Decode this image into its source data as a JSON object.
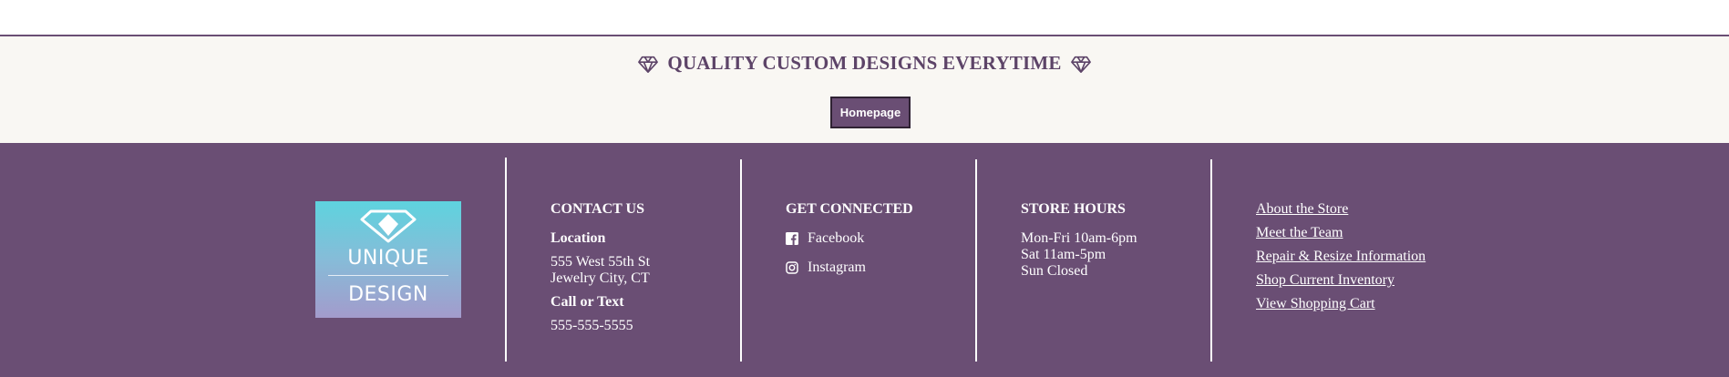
{
  "banner": {
    "tagline": "QUALITY CUSTOM DESIGNS EVERYTIME",
    "homepage_button": "Homepage",
    "icons": [
      "diamond-icon",
      "diamond-icon"
    ]
  },
  "logo": {
    "line1": "UNIQUE",
    "line2": "DESIGN"
  },
  "contact": {
    "heading": "CONTACT US",
    "location_label": "Location",
    "address_line1": "555 West 55th St",
    "address_line2": "Jewelry City, CT",
    "phone_label": "Call or Text",
    "phone": "555-555-5555"
  },
  "connected": {
    "heading": "GET CONNECTED",
    "items": [
      {
        "label": "Facebook",
        "icon": "facebook-icon"
      },
      {
        "label": "Instagram",
        "icon": "instagram-icon"
      }
    ]
  },
  "hours": {
    "heading": "STORE HOURS",
    "lines": [
      "Mon-Fri 10am-6pm",
      "Sat 11am-5pm",
      "Sun Closed"
    ]
  },
  "links": [
    "About the Store",
    "Meet the Team",
    "Repair & Resize Information",
    "Shop Current Inventory",
    "View Shopping Cart"
  ],
  "colors": {
    "brand_purple": "#6a4e74",
    "banner_bg": "#f9f7f3",
    "tagline": "#5d4468",
    "white": "#ffffff"
  }
}
